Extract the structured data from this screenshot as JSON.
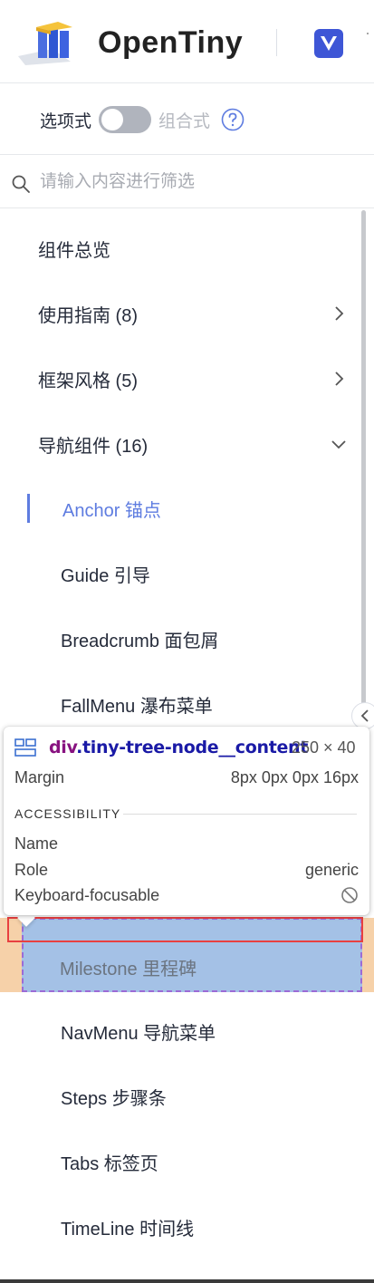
{
  "header": {
    "brand": "OpenTiny",
    "framework_badge": "V",
    "cut_glyph": "·"
  },
  "mode_switch": {
    "options_label": "选项式",
    "composition_label": "组合式",
    "enabled": false
  },
  "search": {
    "placeholder": "请输入内容进行筛选",
    "value": ""
  },
  "menu": {
    "overview": "组件总览",
    "guide": "使用指南 (8)",
    "frame": "框架风格 (5)",
    "nav": "导航组件 (16)",
    "anchor": "Anchor 锚点",
    "guide_leaf": "Guide 引导",
    "breadcrumb": "Breadcrumb 面包屑",
    "fallmenu": "FallMenu 瀑布菜单",
    "milestone": "Milestone 里程碑",
    "navmenu": "NavMenu 导航菜单",
    "steps": "Steps 步骤条",
    "tabs": "Tabs 标签页",
    "timeline": "TimeLine 时间线"
  },
  "tooltip": {
    "tag": "div",
    "class": ".tiny-tree-node__content",
    "size": "250 × 40",
    "margin_label": "Margin",
    "margin_value": "8px 0px 0px 16px",
    "section": "ACCESSIBILITY",
    "name_label": "Name",
    "role_label": "Role",
    "role_value": "generic",
    "focus_label": "Keyboard-focusable"
  },
  "colors": {
    "accent": "#5e7ce0",
    "margin_highlight": "#f4c99a",
    "content_highlight": "#a4c1e6",
    "selection_box": "#e84040"
  },
  "icons": {
    "logo": "opentiny-logo-icon",
    "vue": "vue-icon",
    "help": "question-circle-icon",
    "search": "search-icon",
    "chevron_right": "chevron-right-icon",
    "chevron_down": "chevron-down-icon",
    "collapse": "chevron-left-icon",
    "element": "element-grid-icon",
    "not_focusable": "block-icon"
  }
}
